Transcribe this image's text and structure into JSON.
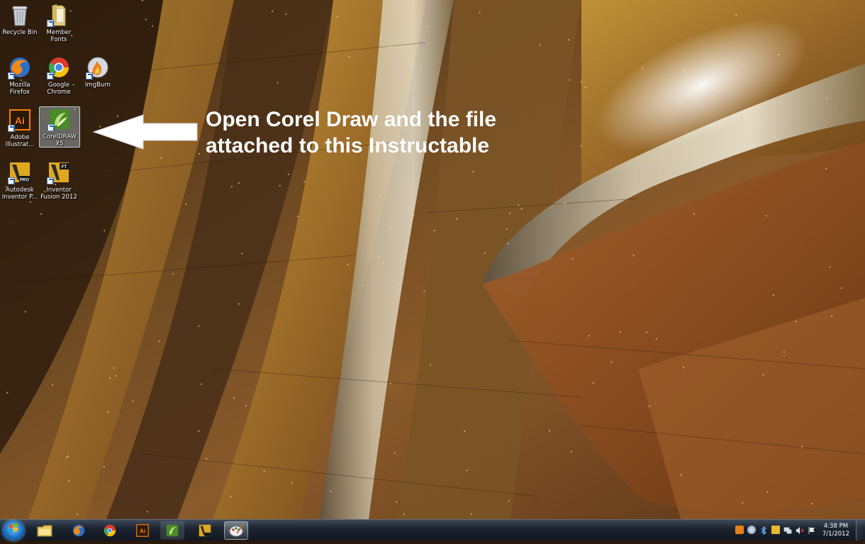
{
  "desktop": {
    "icons": [
      {
        "label": "Recycle Bin",
        "icon": "recycle-bin-icon"
      },
      {
        "label": "Member\nFonts",
        "icon": "folder-icon"
      },
      {
        "label": "Mozilla\nFirefox",
        "icon": "firefox-icon"
      },
      {
        "label": "Google\nChrome",
        "icon": "chrome-icon"
      },
      {
        "label": "ImgBurn",
        "icon": "imgburn-icon"
      },
      {
        "label": "Adobe\nIllustrat...",
        "icon": "illustrator-icon"
      },
      {
        "label": "CorelDRAW\nX5",
        "icon": "coreldraw-icon"
      },
      {
        "label": "Autodesk\nInventor P...",
        "icon": "inventor-pro-icon"
      },
      {
        "label": "Inventor\nFusion 2012",
        "icon": "inventor-fusion-icon"
      }
    ],
    "selected_icon": "CorelDRAW X5"
  },
  "annotation": {
    "text": "Open Corel Draw and the file\nattached to this Instructable",
    "color": "#ffffff"
  },
  "taskbar": {
    "buttons": [
      "start-orb-icon",
      "windows-explorer-icon",
      "firefox-icon",
      "chrome-icon",
      "illustrator-icon",
      "coreldraw-icon",
      "inventor-icon",
      "paint-icon"
    ],
    "active_button": "paint-icon",
    "tray_icons": [
      "app-tray-icon",
      "network-globe-icon",
      "bluetooth-icon",
      "folder-tray-icon",
      "network-icon",
      "volume-muted-icon",
      "flag-icon"
    ],
    "clock_time": "4:38 PM",
    "clock_date": "7/1/2012"
  },
  "colors": {
    "illustrator": "#ff7c00",
    "coreldraw": "#6ab04c",
    "taskbar": "#1c2430"
  }
}
